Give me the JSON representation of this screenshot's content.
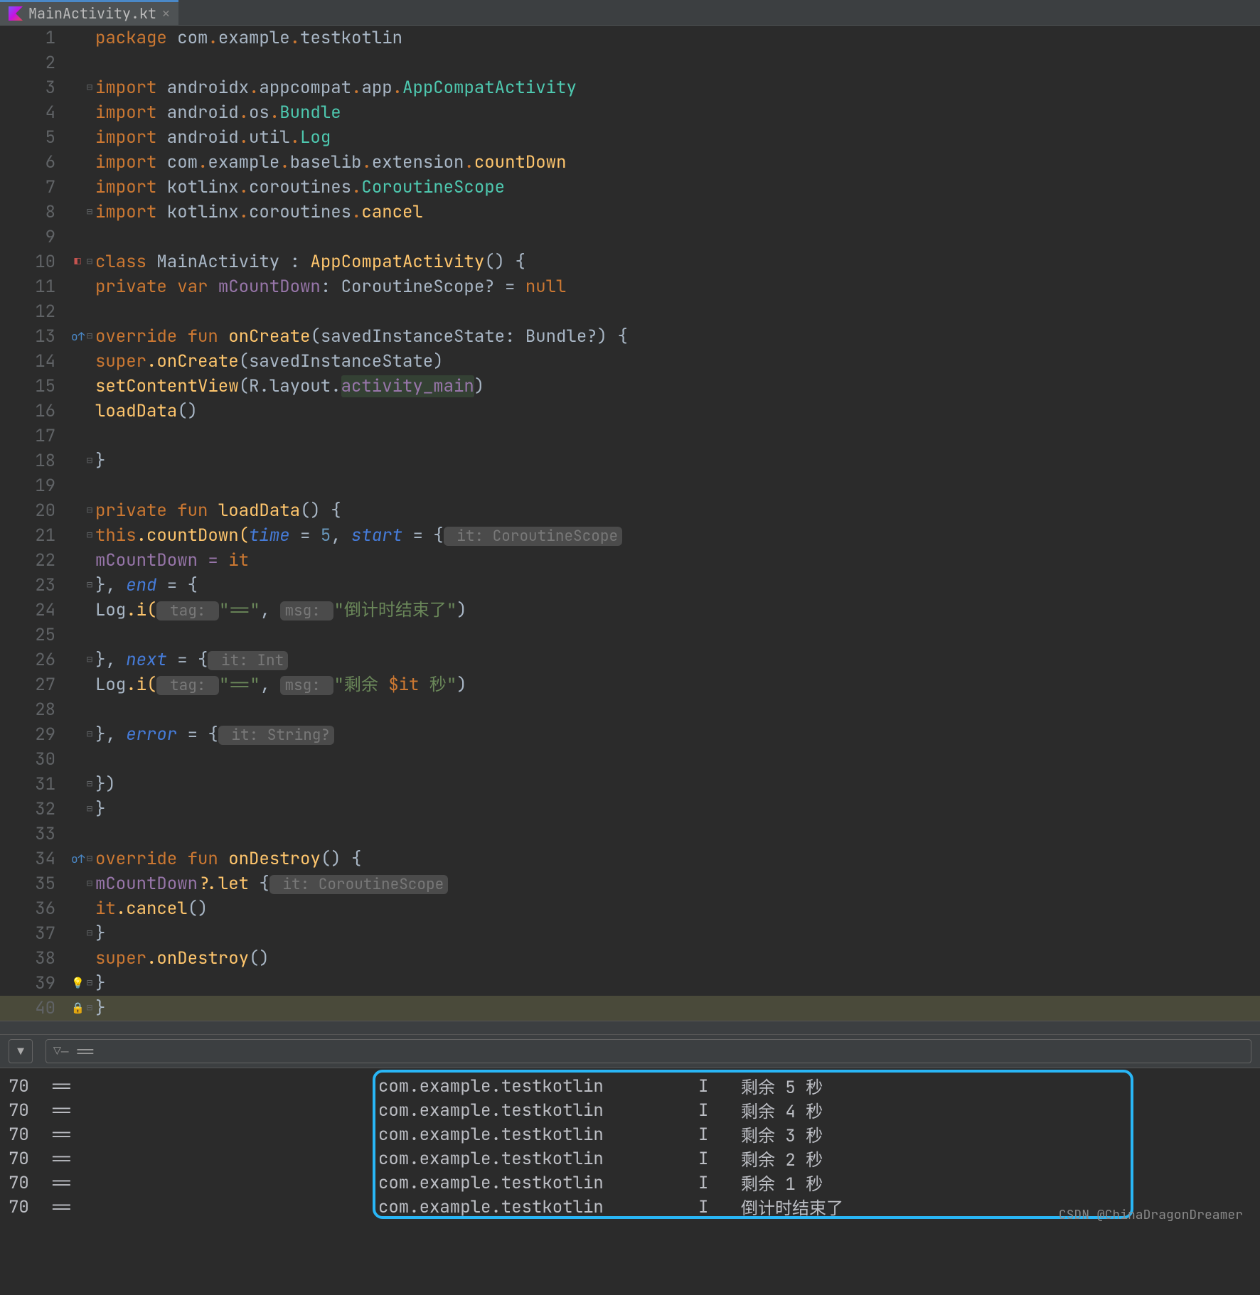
{
  "tab": {
    "name": "MainActivity.kt"
  },
  "code": {
    "pkg_kw": "package",
    "pkg": " com",
    "dot": ".",
    "ex": "example",
    "tk": "testkotlin",
    "imp": "import",
    "ax": " androidx",
    "ac": "appcompat",
    "app": "app",
    "aca": "AppCompatActivity",
    "and": " android",
    "os": "os",
    "bundle": "Bundle",
    "util": "util",
    "log": "Log",
    "com": " com",
    "bl": "baselib",
    "ext": "extension",
    "cd": "countDown",
    "kx": " kotlinx",
    "cr": "coroutines",
    "cs": "CoroutineScope",
    "cancel": "cancel",
    "cls": "class",
    "ma": "MainActivity",
    "colon": " : ",
    "aca2": "AppCompatActivity",
    "paren": "()",
    "ob": " {",
    "priv": "private",
    "var": "var",
    "mcd": "mCountDown",
    "t_cs": ": CoroutineScope? = ",
    "nul": "null",
    "ovr": "override",
    "fun": "fun",
    "onc": "onCreate",
    "p_onc": "(savedInstanceState: ",
    "bdl": "Bundle?",
    "cp": ") {",
    "sup": "super",
    "donc": ".onCreate",
    "sis": "(savedInstanceState)",
    "scv": "setContentView",
    "rlo": "(R.layout.",
    "am": "activity_main",
    "cp2": ")",
    "ld": "loadData",
    "ep": "()",
    "cb": "}",
    "ldf": "loadData",
    "ob2": "() {",
    "this": "this",
    "dcd": ".countDown(",
    "time": "time",
    "eq5": " = ",
    "five": "5",
    ", ": "",
    "start": "start",
    "lamb": " = {",
    "h1": " it: CoroutineScope ",
    "mcd2": "mCountDown = ",
    "it": "it",
    "endp": "}, ",
    "end": "end",
    "lamb2": " = {",
    "logI": "Log",
    "dI": ".i(",
    "htag": " tag: ",
    "eqeq": "\"==\"",
    "cm": ",",
    "hmsg": " msg: ",
    "s1": "\"倒计时结束了\"",
    "cp3": ")",
    "next": "next",
    "hint": " it: Int ",
    "s2": "\"剩余 ",
    "dit": "$it",
    "s3": " 秒\"",
    "err": "error",
    "hs": " it: String? ",
    "cbp": "})",
    "ods": "onDestroy",
    "ob3": "() {",
    "mcdq": "mCountDown?",
    "let": ".let ",
    "lamb3": "{",
    "hcs2": " it: CoroutineScope ",
    "itc": "it",
    "dcan": ".cancel",
    "ep2": "()",
    "dods": ".onDestroy",
    "ep3": "()"
  },
  "filter": {
    "text": "==",
    "icon": "▼"
  },
  "logs": [
    {
      "pid": "70",
      "tag": "==",
      "pkg": "com.example.testkotlin",
      "lvl": "I",
      "msg": "剩余 5 秒"
    },
    {
      "pid": "70",
      "tag": "==",
      "pkg": "com.example.testkotlin",
      "lvl": "I",
      "msg": "剩余 4 秒"
    },
    {
      "pid": "70",
      "tag": "==",
      "pkg": "com.example.testkotlin",
      "lvl": "I",
      "msg": "剩余 3 秒"
    },
    {
      "pid": "70",
      "tag": "==",
      "pkg": "com.example.testkotlin",
      "lvl": "I",
      "msg": "剩余 2 秒"
    },
    {
      "pid": "70",
      "tag": "==",
      "pkg": "com.example.testkotlin",
      "lvl": "I",
      "msg": "剩余 1 秒"
    },
    {
      "pid": "70",
      "tag": "==",
      "pkg": "com.example.testkotlin",
      "lvl": "I",
      "msg": "倒计时结束了"
    }
  ],
  "watermark": "CSDN @ChinaDragonDreamer"
}
